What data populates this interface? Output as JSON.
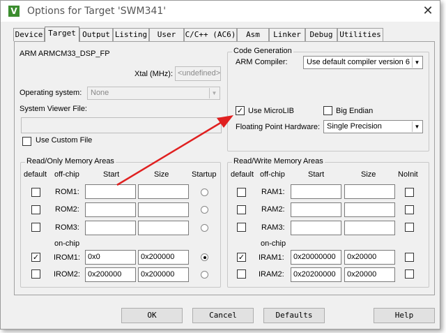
{
  "window": {
    "title": "Options for Target 'SWM341'",
    "app_icon": "V",
    "close_glyph": "✕"
  },
  "tabs": [
    {
      "label": "Device",
      "active": false
    },
    {
      "label": "Target",
      "active": true
    },
    {
      "label": "Output",
      "active": false
    },
    {
      "label": "Listing",
      "active": false
    },
    {
      "label": "User",
      "active": false
    },
    {
      "label": "C/C++ (AC6)",
      "active": false
    },
    {
      "label": "Asm",
      "active": false
    },
    {
      "label": "Linker",
      "active": false
    },
    {
      "label": "Debug",
      "active": false
    },
    {
      "label": "Utilities",
      "active": false
    }
  ],
  "target": {
    "device_name": "ARM ARMCM33_DSP_FP",
    "xtal_label": "Xtal (MHz):",
    "xtal_value": "<undefined>",
    "os_label": "Operating system:",
    "os_value": "None",
    "sysview_label": "System Viewer File:",
    "sysview_value": "",
    "use_custom_file_label": "Use Custom File"
  },
  "codegen": {
    "legend": "Code Generation",
    "compiler_label": "ARM Compiler:",
    "compiler_value": "Use default compiler version 6",
    "microlib_label": "Use MicroLIB",
    "microlib_checked": true,
    "big_endian_label": "Big Endian",
    "big_endian_checked": false,
    "fph_label": "Floating Point Hardware:",
    "fph_value": "Single Precision"
  },
  "rom": {
    "legend": "Read/Only Memory Areas",
    "headers": {
      "default": "default",
      "offchip": "off-chip",
      "start": "Start",
      "size": "Size",
      "startup": "Startup"
    },
    "onchip_label": "on-chip",
    "rows": [
      {
        "name": "ROM1:",
        "default": false,
        "start": "",
        "size": "",
        "startup": false
      },
      {
        "name": "ROM2:",
        "default": false,
        "start": "",
        "size": "",
        "startup": false
      },
      {
        "name": "ROM3:",
        "default": false,
        "start": "",
        "size": "",
        "startup": false
      },
      {
        "name": "IROM1:",
        "default": true,
        "start": "0x0",
        "size": "0x200000",
        "startup": true
      },
      {
        "name": "IROM2:",
        "default": false,
        "start": "0x200000",
        "size": "0x200000",
        "startup": false
      }
    ]
  },
  "ram": {
    "legend": "Read/Write Memory Areas",
    "headers": {
      "default": "default",
      "offchip": "off-chip",
      "start": "Start",
      "size": "Size",
      "noinit": "NoInit"
    },
    "onchip_label": "on-chip",
    "rows": [
      {
        "name": "RAM1:",
        "default": false,
        "start": "",
        "size": "",
        "noinit": false
      },
      {
        "name": "RAM2:",
        "default": false,
        "start": "",
        "size": "",
        "noinit": false
      },
      {
        "name": "RAM3:",
        "default": false,
        "start": "",
        "size": "",
        "noinit": false
      },
      {
        "name": "IRAM1:",
        "default": true,
        "start": "0x20000000",
        "size": "0x20000",
        "noinit": false
      },
      {
        "name": "IRAM2:",
        "default": false,
        "start": "0x20200000",
        "size": "0x20000",
        "noinit": false
      }
    ]
  },
  "buttons": {
    "ok": "OK",
    "cancel": "Cancel",
    "defaults": "Defaults",
    "help": "Help"
  },
  "colors": {
    "annotation_arrow": "#e02020",
    "app_icon_bg": "#3b8d2e"
  }
}
